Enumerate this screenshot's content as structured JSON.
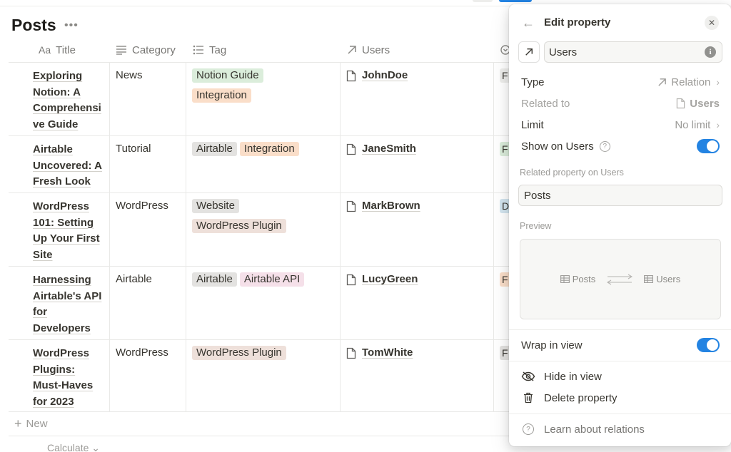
{
  "database": {
    "title": "Posts",
    "more_label": "•••",
    "columns": [
      {
        "label": "Title",
        "prefix": "Aa"
      },
      {
        "label": "Category"
      },
      {
        "label": "Tag"
      },
      {
        "label": "Users"
      }
    ],
    "rows": [
      {
        "title": "Exploring Notion: A Comprehensive Guide",
        "title_lines": [
          "Exploring",
          "Notion: A",
          "Comprehensi",
          "ve Guide"
        ],
        "category": "News",
        "tags": [
          "Notion Guide",
          "Integration"
        ],
        "user": "JohnDoe",
        "stub": "F"
      },
      {
        "title": "Airtable Uncovered: A Fresh Look",
        "title_lines": [
          "Airtable",
          "Uncovered: A",
          "Fresh Look"
        ],
        "category": "Tutorial",
        "tags": [
          "Airtable",
          "Integration"
        ],
        "user": "JaneSmith",
        "stub": "F"
      },
      {
        "title": "WordPress 101: Setting Up Your First Site",
        "title_lines": [
          "WordPress",
          "101: Setting",
          "Up Your First",
          "Site"
        ],
        "category": "WordPress",
        "tags": [
          "Website",
          "WordPress Plugin"
        ],
        "user": "MarkBrown",
        "stub": "D"
      },
      {
        "title": "Harnessing Airtable's API for Developers",
        "title_lines": [
          "Harnessing",
          "Airtable's API",
          "for",
          "Developers"
        ],
        "category": "Airtable",
        "tags": [
          "Airtable",
          "Airtable API"
        ],
        "user": "LucyGreen",
        "stub": "F"
      },
      {
        "title": "WordPress Plugins: Must-Haves for 2023",
        "title_lines": [
          "WordPress",
          "Plugins:",
          "Must-Haves",
          "for 2023"
        ],
        "category": "WordPress",
        "tags": [
          "WordPress Plugin"
        ],
        "user": "TomWhite",
        "stub": "F"
      }
    ],
    "new_label": "New",
    "calculate_label": "Calculate"
  },
  "tag_colors": {
    "Notion Guide": "#dbeddb",
    "Integration": "#fadec9",
    "Airtable": "#e3e2e0",
    "Website": "#e3e2e0",
    "WordPress Plugin": "#eee0da",
    "Airtable API": "#f5e0e9"
  },
  "panel": {
    "title": "Edit property",
    "property_name": "Users",
    "type_label": "Type",
    "type_value": "Relation",
    "related_to_label": "Related to",
    "related_to_value": "Users",
    "limit_label": "Limit",
    "limit_value": "No limit",
    "show_on_label": "Show on Users",
    "show_on_enabled": true,
    "related_property_label": "Related property on Users",
    "related_property_value": "Posts",
    "preview_label": "Preview",
    "preview_left": "Posts",
    "preview_right": "Users",
    "wrap_label": "Wrap in view",
    "wrap_enabled": true,
    "hide_label": "Hide in view",
    "delete_label": "Delete property",
    "learn_label": "Learn about relations"
  },
  "colors": {
    "accent": "#2383e2",
    "text": "#37352f",
    "muted": "#9b9a97"
  }
}
